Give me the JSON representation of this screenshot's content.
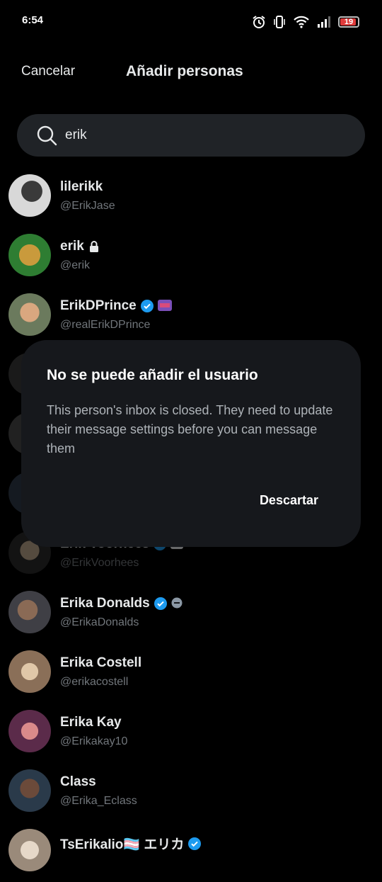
{
  "status_bar": {
    "time": "6:54",
    "battery": "19",
    "icons": [
      "alarm-icon",
      "vibrate-icon",
      "wifi-icon",
      "signal-icon",
      "battery-icon"
    ]
  },
  "header": {
    "cancel": "Cancelar",
    "title": "Añadir personas"
  },
  "search": {
    "icon": "search-icon",
    "value": "erik"
  },
  "users": [
    {
      "name": "lilerikk",
      "handle": "@ErikJase",
      "badges": []
    },
    {
      "name": "erik",
      "handle": "@erik",
      "badges": [
        "lock-icon"
      ]
    },
    {
      "name": "ErikDPrince",
      "handle": "@realErikDPrince",
      "badges": [
        "verified-icon",
        "affiliate-badge"
      ]
    },
    {
      "name": "",
      "handle": "",
      "badges": []
    },
    {
      "name": "",
      "handle": "",
      "badges": []
    },
    {
      "name": "",
      "handle": "",
      "badges": []
    },
    {
      "name": "Erik Voorhees",
      "handle": "@ErikVoorhees",
      "badges": [
        "verified-icon",
        "affiliate-badge"
      ]
    },
    {
      "name": "Erika Donalds",
      "handle": "@ErikaDonalds",
      "badges": [
        "verified-icon",
        "government-badge"
      ]
    },
    {
      "name": "Erika Costell",
      "handle": "@erikacostell",
      "badges": []
    },
    {
      "name": "Erika Kay",
      "handle": "@Erikakay10",
      "badges": []
    },
    {
      "name": "Class",
      "handle": "@Erika_Eclass",
      "badges": []
    },
    {
      "name": "TsErikalio🏳️‍⚧️ エリカ",
      "handle": "",
      "badges": [
        "verified-icon"
      ]
    }
  ],
  "dialog": {
    "title": "No se puede añadir el usuario",
    "message": "This person's inbox is closed. They need to update their message settings before you can message them",
    "dismiss": "Descartar"
  },
  "colors": {
    "background": "#000000",
    "dialog_bg": "#16181c",
    "search_bg": "#202327",
    "verified": "#1d9bf0",
    "secondary_text": "#71767b"
  }
}
